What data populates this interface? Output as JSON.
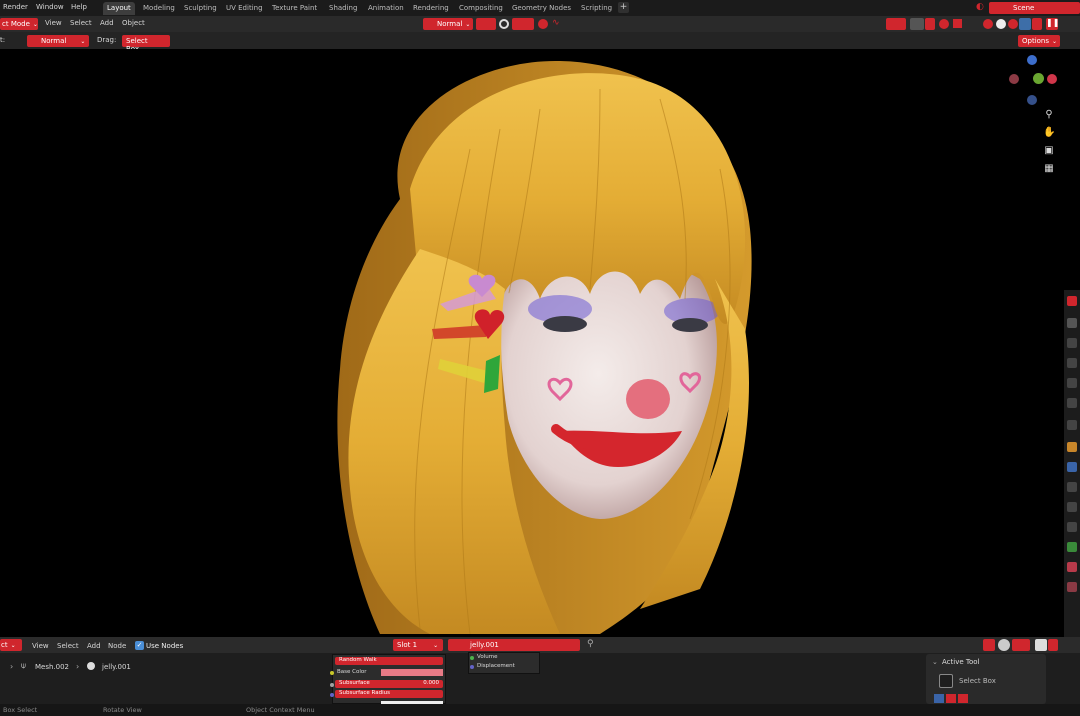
{
  "top_menu": {
    "items": [
      "Render",
      "Window",
      "Help"
    ],
    "workspaces": [
      "Layout",
      "Modeling",
      "Sculpting",
      "UV Editing",
      "Texture Paint",
      "Shading",
      "Animation",
      "Rendering",
      "Compositing",
      "Geometry Nodes",
      "Scripting"
    ],
    "active_workspace": "Layout",
    "add_tab": "+",
    "scene_label": "Scene"
  },
  "viewport_header": {
    "mode": "ct Mode",
    "menus": [
      "View",
      "Select",
      "Add",
      "Object"
    ],
    "orientation": "Normal"
  },
  "tool_settings": {
    "orient_label": "t:",
    "orient_value": "Normal",
    "drag_label": "Drag:",
    "drag_value": "Select Box",
    "options_label": "Options"
  },
  "node_editor": {
    "type_label": "ct",
    "menus": [
      "View",
      "Select",
      "Add",
      "Node"
    ],
    "use_nodes_label": "Use Nodes",
    "use_nodes_checked": true,
    "slot": "Slot 1",
    "material": "jelly.001",
    "breadcrumb": {
      "mesh": "Mesh.002",
      "material": "jelly.001"
    },
    "principled_node": {
      "subsurface_method": "Random Walk",
      "rows": [
        "Base Color",
        "Subsurface",
        "Subsurface Radius"
      ],
      "subsurface_value": "0.000"
    },
    "output_node": {
      "rows": [
        "Volume",
        "Displacement"
      ]
    }
  },
  "active_tool_panel": {
    "title": "Active Tool",
    "tool": "Select Box"
  },
  "status_bar": {
    "items": [
      "Box Select",
      "Rotate View",
      "Object Context Menu"
    ]
  },
  "colors": {
    "accent_red": "#d0262d",
    "hair": "#e8b43a",
    "background": "#000000"
  }
}
